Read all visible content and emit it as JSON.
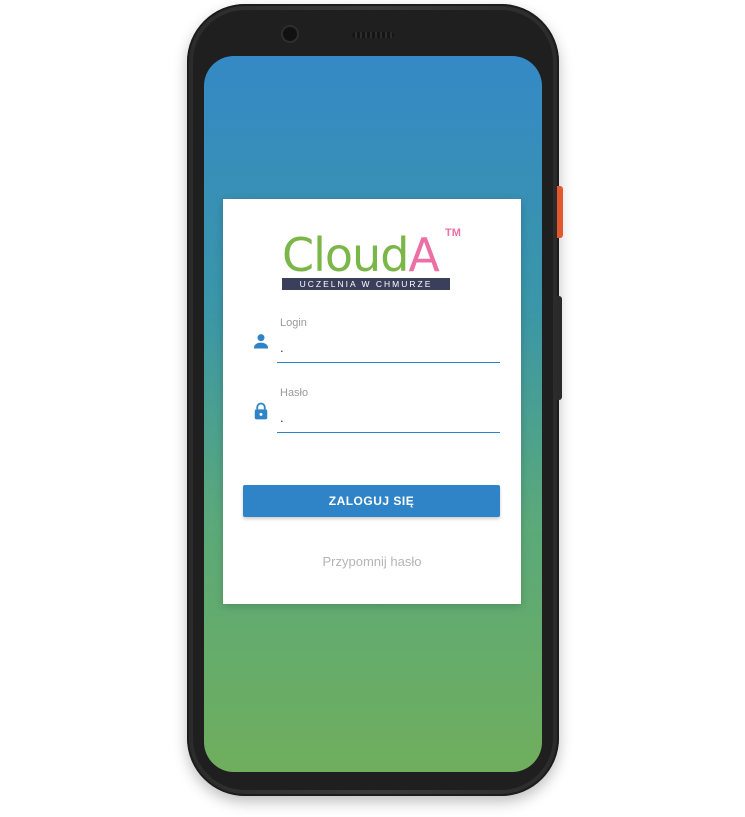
{
  "app": {
    "logo": {
      "name_main": "Cloud",
      "name_accent": "A",
      "trademark": "TM",
      "tagline": "UCZELNIA W CHMURZE"
    }
  },
  "login_form": {
    "login_field": {
      "label": "Login",
      "value": ".",
      "icon": "person-icon"
    },
    "password_field": {
      "label": "Hasło",
      "value": ".",
      "icon": "lock-icon"
    },
    "submit_label": "ZALOGUJ SIĘ",
    "remind_password_label": "Przypomnij hasło"
  },
  "colors": {
    "primary": "#2f83c7",
    "logo_green": "#7ab648",
    "logo_pink": "#ec6fa6",
    "gradient_top": "#3589c6",
    "gradient_bottom": "#6fae5d"
  }
}
